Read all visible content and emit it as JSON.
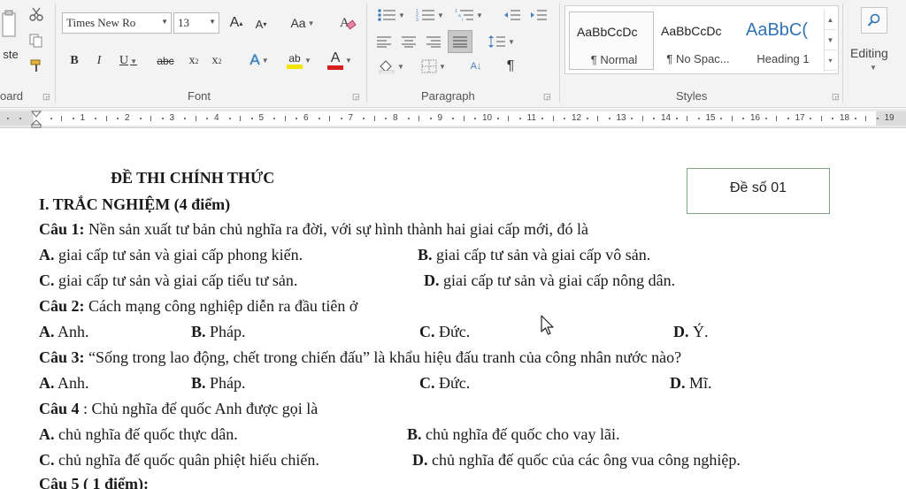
{
  "ribbon": {
    "clipboard": {
      "paste_label": "ste",
      "group_label": "oard"
    },
    "font": {
      "font_name": "Times New Ro",
      "font_size": "13",
      "grow_label": "A",
      "shrink_label": "A",
      "case_label": "Aa",
      "bold_label": "B",
      "italic_label": "I",
      "underline_label": "U",
      "strike_label": "abc",
      "subscript_label": "x",
      "superscript_label": "x",
      "effects_label": "A",
      "highlight_label": "ab",
      "color_label": "A",
      "group_label": "Font"
    },
    "paragraph": {
      "pilcrow_label": "¶",
      "sort_label": "A↓",
      "group_label": "Paragraph"
    },
    "styles": {
      "items": [
        {
          "sample": "AaBbCcDc",
          "name": "¶ Normal"
        },
        {
          "sample": "AaBbCcDc",
          "name": "¶ No Spac..."
        },
        {
          "sample": "AaBbC(",
          "name": "Heading 1"
        }
      ],
      "group_label": "Styles"
    },
    "editing": {
      "label": "Editing"
    },
    "colors": {
      "highlight": "#f2e600",
      "font_color": "#d62020",
      "heading": "#2e74b5"
    }
  },
  "ruler": {
    "numbers": [
      "1",
      "2",
      "3",
      "4",
      "5",
      "6",
      "7",
      "8",
      "9",
      "10",
      "11",
      "12",
      "13",
      "14",
      "15",
      "16",
      "17",
      "18",
      "19"
    ]
  },
  "document": {
    "title": "ĐỀ THI CHÍNH THỨC",
    "exam_code": "Đề số 01",
    "section": "I. TRẮC NGHIỆM (4 điểm)",
    "q1": {
      "label": "Câu 1:",
      "text": " Nền sản xuất tư bản chủ nghĩa ra đời, với sự hình thành hai giai cấp mới, đó là",
      "a": {
        "label": "A.",
        "text": " giai cấp tư sản và giai cấp phong kiến."
      },
      "b": {
        "label": "B.",
        "text": " giai cấp tư sản và giai cấp vô sản."
      },
      "c": {
        "label": "C.",
        "text": " giai cấp tư sản và giai cấp tiểu tư sản."
      },
      "d": {
        "label": "D.",
        "text": " giai cấp tư sản và giai cấp nông dân."
      }
    },
    "q2": {
      "label": "Câu 2:",
      "text": " Cách mạng công nghiệp diễn ra đầu tiên ở",
      "a": {
        "label": "A.",
        "text": " Anh."
      },
      "b": {
        "label": "B.",
        "text": " Pháp."
      },
      "c": {
        "label": "C.",
        "text": " Đức."
      },
      "d": {
        "label": "D.",
        "text": " Ý."
      }
    },
    "q3": {
      "label": "Câu 3:",
      "text": " “Sống trong lao động, chết trong chiến đấu” là khẩu hiệu đấu tranh của công nhân nước nào?",
      "a": {
        "label": "A.",
        "text": " Anh."
      },
      "b": {
        "label": "B.",
        "text": " Pháp."
      },
      "c": {
        "label": "C.",
        "text": " Đức."
      },
      "d": {
        "label": "D.",
        "text": " Mĩ."
      }
    },
    "q4": {
      "label": "Câu 4",
      "text": " : Chủ nghĩa đế quốc Anh được gọi là",
      "a": {
        "label": "A.",
        "text": " chủ nghĩa đế quốc thực dân."
      },
      "b": {
        "label": "B.",
        "text": " chủ nghĩa đế quốc cho vay lãi."
      },
      "c": {
        "label": "C.",
        "text": " chủ nghĩa đế quốc quân phiệt hiếu chiến."
      },
      "d": {
        "label": "D.",
        "text": " chủ nghĩa đế quốc của các ông vua công nghiệp."
      }
    },
    "q5": {
      "label": "Câu 5 ( 1 điểm):"
    }
  }
}
